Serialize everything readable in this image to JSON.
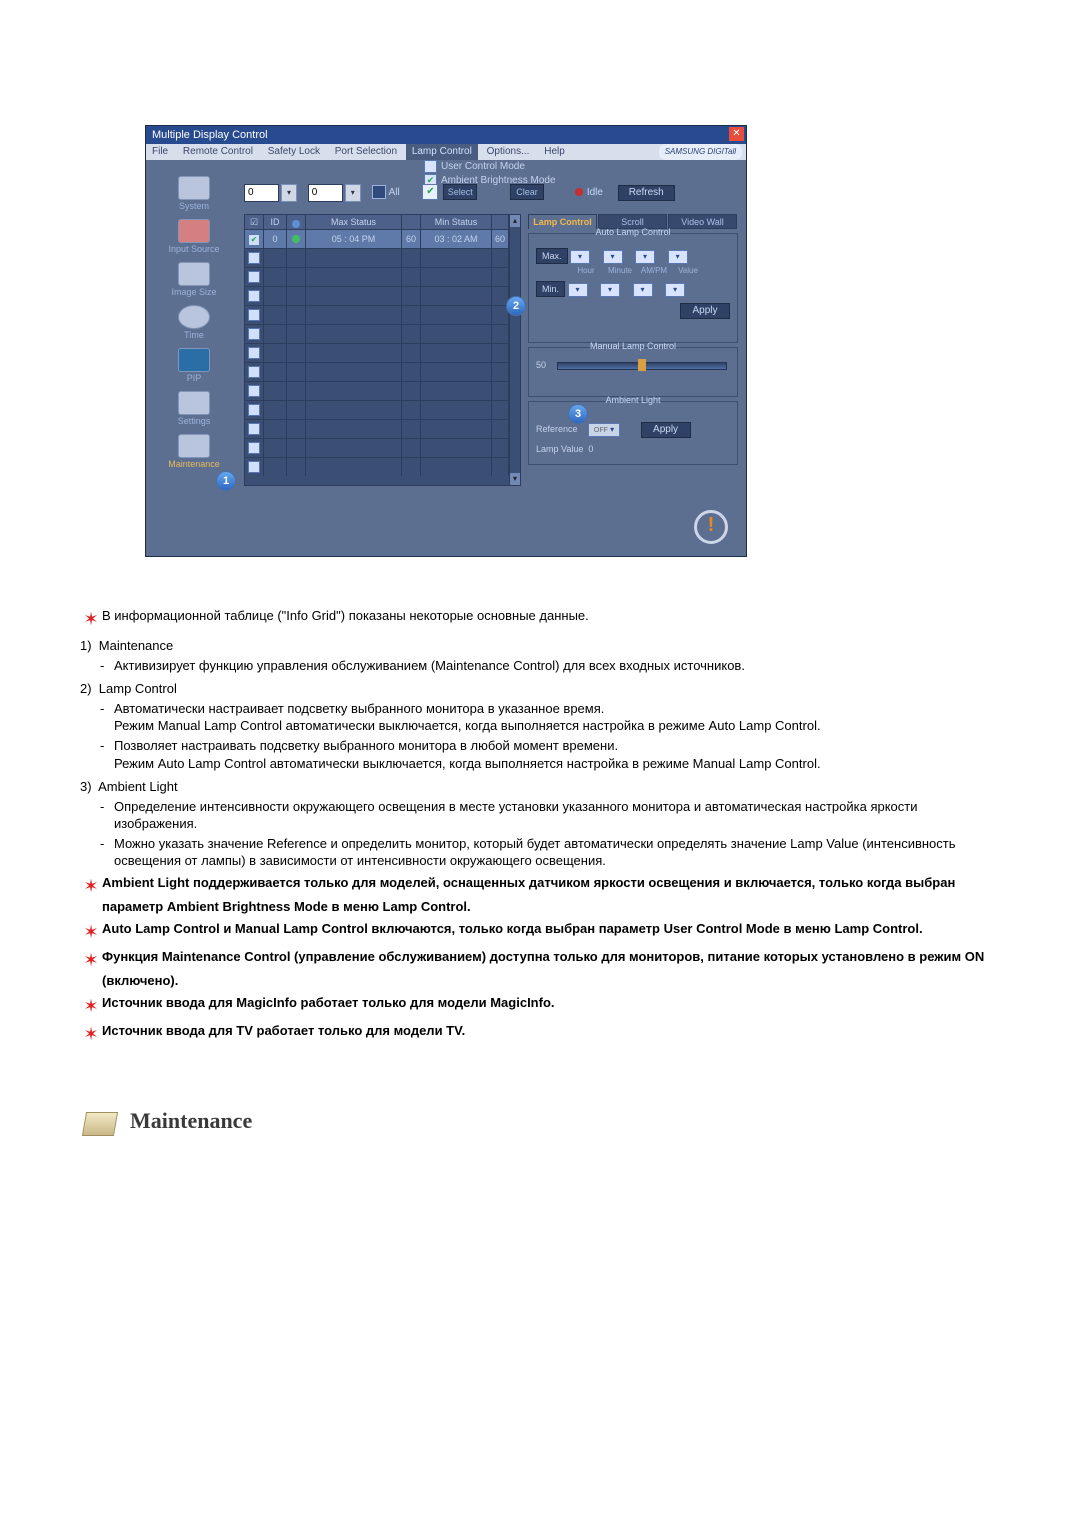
{
  "window": {
    "title": "Multiple Display Control"
  },
  "menu": {
    "file": "File",
    "remote": "Remote Control",
    "safety": "Safety Lock",
    "port": "Port Selection",
    "lamp": "Lamp Control",
    "options": "Options...",
    "help": "Help",
    "brand": "SAMSUNG DIGITall"
  },
  "submenu": {
    "user": "User Control Mode",
    "ambient": "Ambient Brightness Mode",
    "select": "Select",
    "clear": "Clear"
  },
  "toprow": {
    "n1": "0",
    "n2": "0",
    "all": "All",
    "idle": "Idle",
    "refresh": "Refresh"
  },
  "sidebar": {
    "items": [
      {
        "label": "System"
      },
      {
        "label": "Input Source"
      },
      {
        "label": "Image Size"
      },
      {
        "label": "Time"
      },
      {
        "label": "PIP"
      },
      {
        "label": "Settings"
      },
      {
        "label": "Maintenance"
      }
    ]
  },
  "grid": {
    "head": {
      "ck": "☑",
      "id": "ID",
      "st": "●",
      "max": "Max Status",
      "v1": "",
      "min": "Min Status",
      "v2": ""
    },
    "row0": {
      "id": "0",
      "max": "05 : 04 PM",
      "v1": "60",
      "min": "03 : 02 AM",
      "v2": "60"
    }
  },
  "tabs": {
    "lamp": "Lamp Control",
    "scroll": "Scroll",
    "video": "Video Wall"
  },
  "auto": {
    "legend": "Auto Lamp Control",
    "max": "Max.",
    "min": "Min.",
    "h": "Hour",
    "m": "Minute",
    "ap": "AM/PM",
    "v": "Value",
    "apply": "Apply"
  },
  "manual": {
    "legend": "Manual Lamp Control",
    "value": "50"
  },
  "amb": {
    "legend": "Ambient Light",
    "ref": "Reference",
    "off": "OFF",
    "apply": "Apply",
    "lamp": "Lamp Value",
    "lampv": "0"
  },
  "callouts": {
    "c1": "1",
    "c2": "2",
    "c3": "3"
  },
  "notes": {
    "intro": "В информационной таблице (\"Info Grid\") показаны некоторые основные данные.",
    "n1": "Maintenance",
    "n1a": "Активизирует функцию управления обслуживанием (Maintenance Control) для всех входных источников.",
    "n2": "Lamp Control",
    "n2a": "Автоматически настраивает подсветку выбранного монитора в указанное время.\nРежим Manual Lamp Control автоматически выключается, когда выполняется настройка в режиме Auto Lamp Control.",
    "n2b": "Позволяет настраивать подсветку выбранного монитора в любой момент времени.\nРежим Auto Lamp Control автоматически выключается, когда выполняется настройка в режиме Manual Lamp Control.",
    "n3": "Ambient Light",
    "n3a": "Определение интенсивности окружающего освещения в месте установки указанного монитора и автоматическая настройка яркости изображения.",
    "n3b": "Можно указать значение Reference и определить монитор, который будет автоматически определять значение Lamp Value (интенсивность освещения от лампы) в зависимости от интенсивности окружающего освещения.",
    "b1": "Ambient Light поддерживается только для моделей, оснащенных датчиком яркости освещения и включается, только когда выбран параметр Ambient Brightness Mode в меню Lamp Control.",
    "b2": "Auto Lamp Control и Manual Lamp Control включаются, только когда выбран параметр User Control Mode в меню Lamp Control.",
    "b3": "Функция Maintenance Control (управление обслуживанием) доступна только для мониторов, питание которых установлено в режим ON (включено).",
    "b4": "Источник ввода для MagicInfo работает только для модели MagicInfo.",
    "b5": "Источник ввода для TV работает только для модели TV."
  },
  "section": {
    "title": "Maintenance"
  }
}
